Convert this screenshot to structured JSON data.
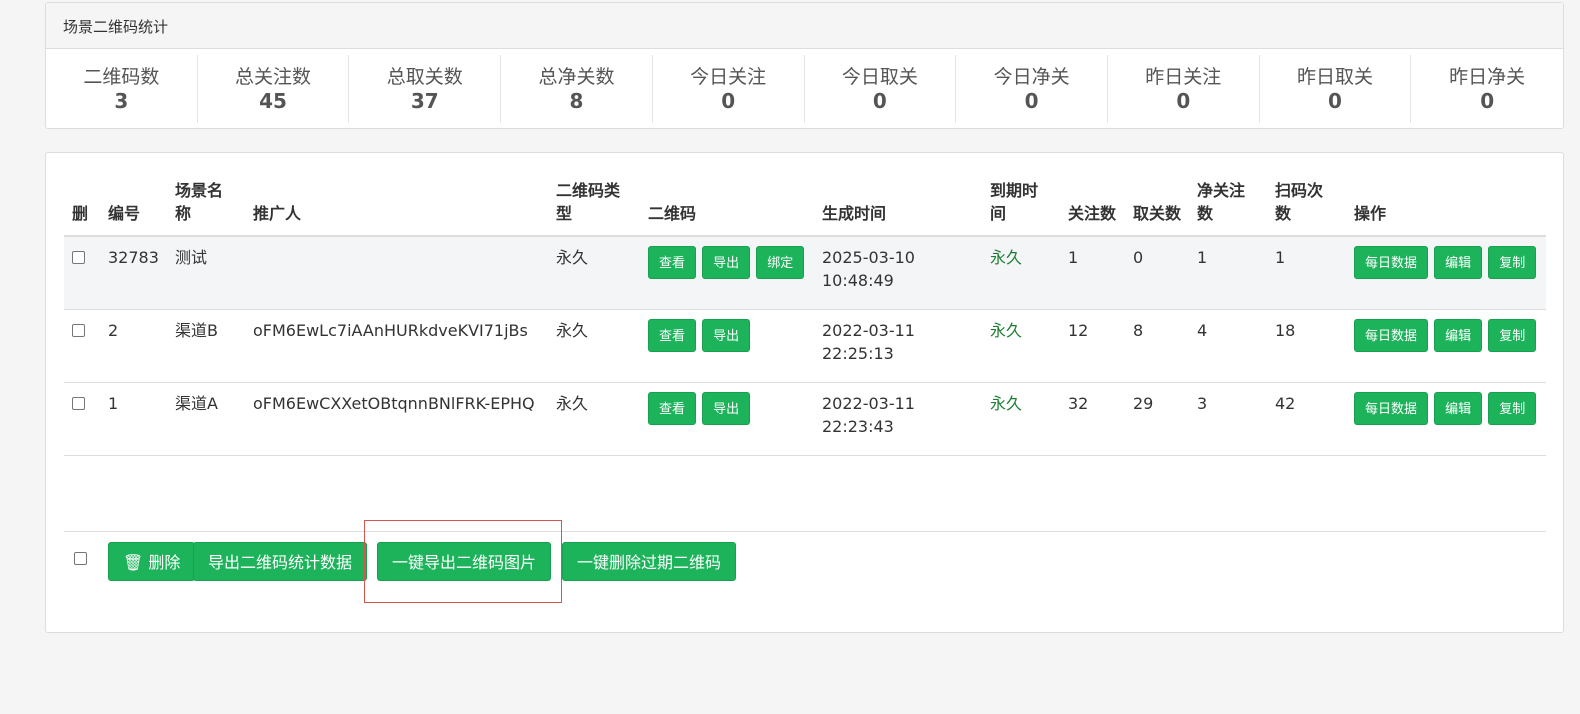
{
  "stats": {
    "heading": "场景二维码统计",
    "items": [
      {
        "label": "二维码数",
        "value": "3"
      },
      {
        "label": "总关注数",
        "value": "45"
      },
      {
        "label": "总取关数",
        "value": "37"
      },
      {
        "label": "总净关数",
        "value": "8"
      },
      {
        "label": "今日关注",
        "value": "0"
      },
      {
        "label": "今日取关",
        "value": "0"
      },
      {
        "label": "今日净关",
        "value": "0"
      },
      {
        "label": "昨日关注",
        "value": "0"
      },
      {
        "label": "昨日取关",
        "value": "0"
      },
      {
        "label": "昨日净关",
        "value": "0"
      }
    ]
  },
  "table": {
    "headers": {
      "del": "删",
      "id": "编号",
      "scene": "场景名称",
      "promoter": "推广人",
      "qr_type": "二维码类型",
      "qr": "二维码",
      "created": "生成时间",
      "expire": "到期时间",
      "follow": "关注数",
      "unfollow": "取关数",
      "net": "净关注数",
      "scans": "扫码次数",
      "ops": "操作"
    },
    "rows": [
      {
        "id": "32783",
        "scene": "测试",
        "promoter": "",
        "qr_type": "永久",
        "created": "2025-03-10 10:48:49",
        "expire": "永久",
        "follow": "1",
        "unfollow": "0",
        "net": "1",
        "scans": "1"
      },
      {
        "id": "2",
        "scene": "渠道B",
        "promoter": "oFM6EwLc7iAAnHURkdveKVI71jBs",
        "qr_type": "永久",
        "created": "2022-03-11 22:25:13",
        "expire": "永久",
        "follow": "12",
        "unfollow": "8",
        "net": "4",
        "scans": "18"
      },
      {
        "id": "1",
        "scene": "渠道A",
        "promoter": "oFM6EwCXXetOBtqnnBNlFRK-EPHQ",
        "qr_type": "永久",
        "created": "2022-03-11 22:23:43",
        "expire": "永久",
        "follow": "32",
        "unfollow": "29",
        "net": "3",
        "scans": "42"
      }
    ],
    "row_buttons": {
      "view": "查看",
      "export": "导出",
      "bind": "绑定",
      "daily": "每日数据",
      "edit": "编辑",
      "copy": "复制"
    }
  },
  "footer": {
    "delete": "删除",
    "export_stats": "导出二维码统计数据",
    "export_images": "一键导出二维码图片",
    "delete_expired": "一键删除过期二维码"
  }
}
